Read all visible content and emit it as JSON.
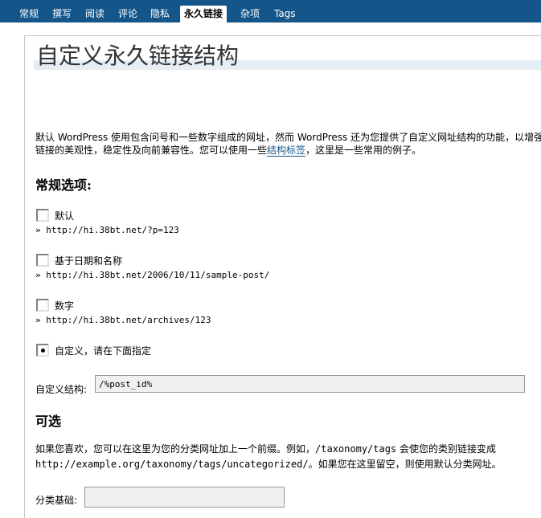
{
  "nav": {
    "tabs": [
      {
        "label": "常规"
      },
      {
        "label": "撰写"
      },
      {
        "label": "阅读"
      },
      {
        "label": "评论"
      },
      {
        "label": "隐私"
      },
      {
        "label": "永久链接"
      },
      {
        "label": "杂项"
      },
      {
        "label": "Tags"
      }
    ],
    "active_tab": "永久链接"
  },
  "page": {
    "title": "自定义永久链接结构",
    "intro_line1": "默认 WordPress 使用包含问号和一些数字组成的网址，然而 WordPress 还为您提供了自定义网址结构的功能，以增强",
    "intro_line2_before": "链接的美观性，稳定性及向前兼容性。您可以使用一些",
    "intro_link": "结构标签",
    "intro_line2_after": "，这里是一些常用的例子。"
  },
  "common": {
    "heading": "常规选项:",
    "options": [
      {
        "label": "默认",
        "example": "» http://hi.38bt.net/?p=123",
        "checked": false
      },
      {
        "label": "基于日期和名称",
        "example": "» http://hi.38bt.net/2006/10/11/sample-post/",
        "checked": false
      },
      {
        "label": "数字",
        "example": "» http://hi.38bt.net/archives/123",
        "checked": false
      },
      {
        "label": "自定义，请在下面指定",
        "example": "",
        "checked": true
      }
    ],
    "custom_label": "自定义结构:",
    "custom_value": "/%post_id%"
  },
  "optional": {
    "heading": "可选",
    "line1_before": "如果您喜欢，您可以在这里为您的分类网址加上一个前缀。例如，",
    "line1_code": "/taxonomy/tags",
    "line1_after": " 会使您的类别链接变成",
    "line2_code": "http://example.org/taxonomy/tags/uncategorized/",
    "line2_after": "。如果您在这里留空，则使用默认分类网址。",
    "category_base_label": "分类基础:",
    "category_base_value": ""
  }
}
